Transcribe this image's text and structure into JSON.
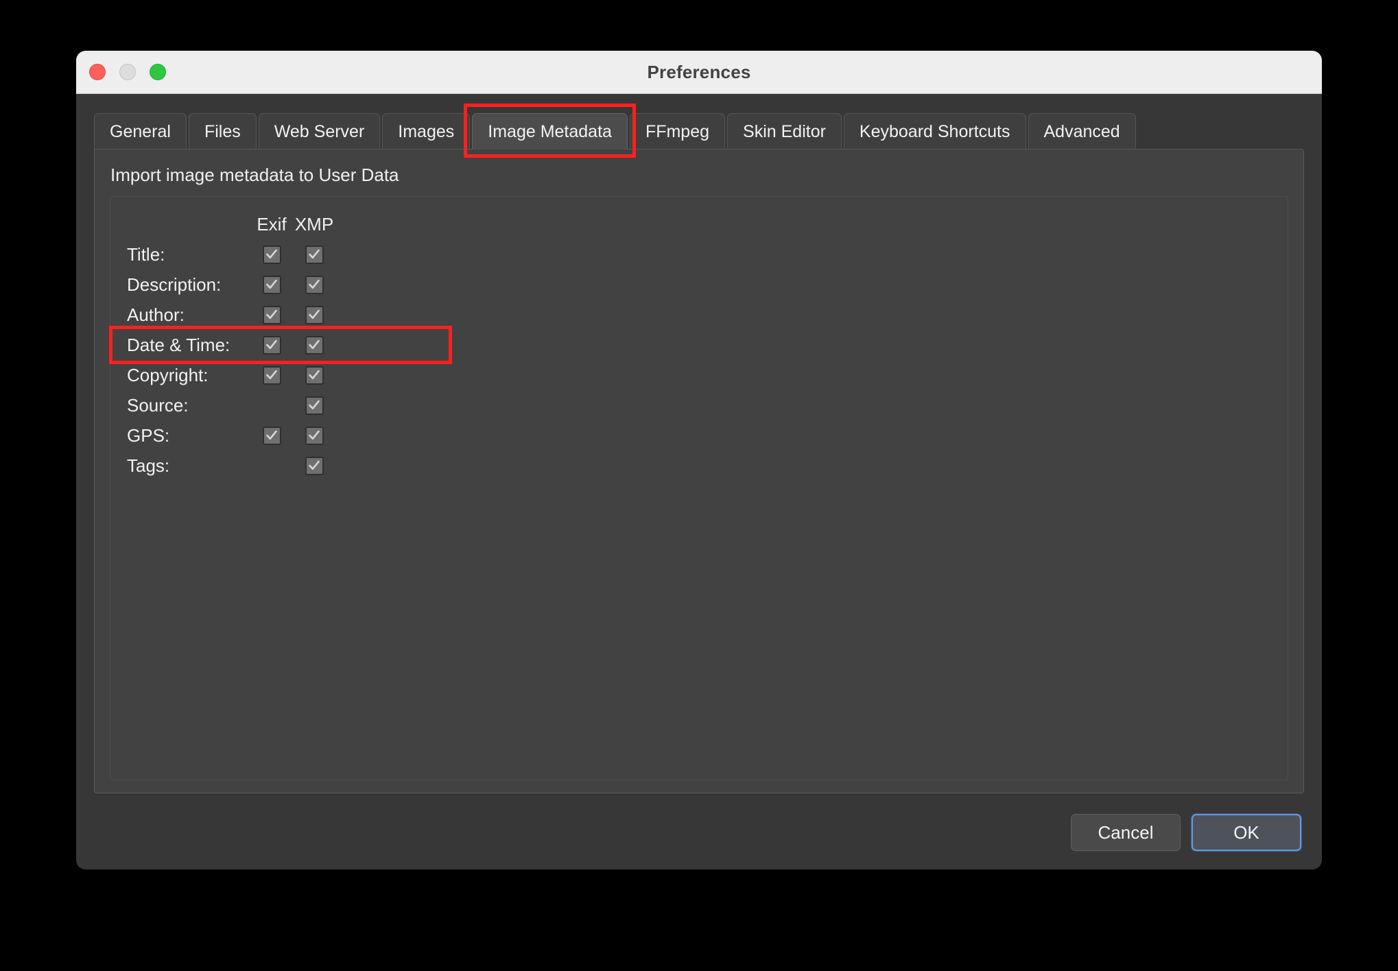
{
  "window": {
    "title": "Preferences",
    "traffic_lights": [
      "close-button",
      "minimize-button",
      "maximize-button"
    ]
  },
  "tabs": [
    {
      "label": "General",
      "selected": false
    },
    {
      "label": "Files",
      "selected": false
    },
    {
      "label": "Web Server",
      "selected": false
    },
    {
      "label": "Images",
      "selected": false
    },
    {
      "label": "Image Metadata",
      "selected": true
    },
    {
      "label": "FFmpeg",
      "selected": false
    },
    {
      "label": "Skin Editor",
      "selected": false
    },
    {
      "label": "Keyboard Shortcuts",
      "selected": false
    },
    {
      "label": "Advanced",
      "selected": false
    }
  ],
  "content": {
    "section_title": "Import image metadata to User Data",
    "columns": [
      "Exif",
      "XMP"
    ],
    "rows": [
      {
        "label": "Title:",
        "exif": true,
        "xmp": true,
        "exif_present": true,
        "xmp_present": true
      },
      {
        "label": "Description:",
        "exif": true,
        "xmp": true,
        "exif_present": true,
        "xmp_present": true
      },
      {
        "label": "Author:",
        "exif": true,
        "xmp": true,
        "exif_present": true,
        "xmp_present": true
      },
      {
        "label": "Date & Time:",
        "exif": true,
        "xmp": true,
        "exif_present": true,
        "xmp_present": true
      },
      {
        "label": "Copyright:",
        "exif": true,
        "xmp": true,
        "exif_present": true,
        "xmp_present": true
      },
      {
        "label": "Source:",
        "exif": false,
        "xmp": true,
        "exif_present": false,
        "xmp_present": true
      },
      {
        "label": "GPS:",
        "exif": true,
        "xmp": true,
        "exif_present": true,
        "xmp_present": true
      },
      {
        "label": "Tags:",
        "exif": false,
        "xmp": true,
        "exif_present": false,
        "xmp_present": true
      }
    ]
  },
  "footer": {
    "cancel_label": "Cancel",
    "ok_label": "OK"
  },
  "annotations": {
    "highlight_color": "#fb2020",
    "boxes": [
      {
        "name": "tab-image-metadata-highlight",
        "target": "Image Metadata"
      },
      {
        "name": "row-date-time-highlight",
        "target": "Date & Time:"
      }
    ]
  },
  "colors": {
    "titlebar": "#eeeeee",
    "window_body": "#373737",
    "panel": "#424242",
    "tab_selected": "#4c4c4c",
    "tab_normal": "#3f3f3f",
    "accent_focus": "#5d9bec",
    "checkbox_fill": "#6f6f6f",
    "highlight": "#fb2020"
  }
}
